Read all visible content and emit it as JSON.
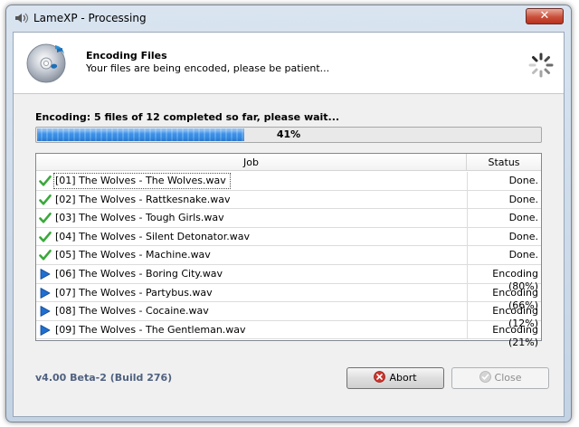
{
  "window": {
    "title": "LameXP - Processing",
    "close_glyph": "✕"
  },
  "header": {
    "title": "Encoding Files",
    "subtitle": "Your files are being encoded, please be patient..."
  },
  "status": {
    "text": "Encoding: 5 files of 12 completed so far, please wait..."
  },
  "progress": {
    "percent": 41,
    "label": "41%"
  },
  "table": {
    "columns": [
      "Job",
      "Status"
    ],
    "rows": [
      {
        "job": "[01] The Wolves - The Wolves.wav",
        "status": "Done.",
        "icon": "check-icon"
      },
      {
        "job": "[02] The Wolves - Rattkesnake.wav",
        "status": "Done.",
        "icon": "check-icon"
      },
      {
        "job": "[03] The Wolves - Tough Girls.wav",
        "status": "Done.",
        "icon": "check-icon"
      },
      {
        "job": "[04] The Wolves - Silent Detonator.wav",
        "status": "Done.",
        "icon": "check-icon"
      },
      {
        "job": "[05] The Wolves - Machine.wav",
        "status": "Done.",
        "icon": "check-icon"
      },
      {
        "job": "[06] The Wolves - Boring City.wav",
        "status": "Encoding (80%)",
        "icon": "play-icon"
      },
      {
        "job": "[07] The Wolves - Partybus.wav",
        "status": "Encoding (66%)",
        "icon": "play-icon"
      },
      {
        "job": "[08] The Wolves - Cocaine.wav",
        "status": "Encoding (12%)",
        "icon": "play-icon"
      },
      {
        "job": "[09] The Wolves - The Gentleman.wav",
        "status": "Encoding (21%)",
        "icon": "play-icon"
      }
    ]
  },
  "footer": {
    "version": "v4.00 Beta-2 (Build 276)",
    "abort_label": "Abort",
    "close_label": "Close"
  },
  "colors": {
    "progress": "#3a8ee6",
    "check": "#3aa83a",
    "play": "#1f6fd1",
    "abort_icon": "#d0342c",
    "version_text": "#4f6180"
  }
}
